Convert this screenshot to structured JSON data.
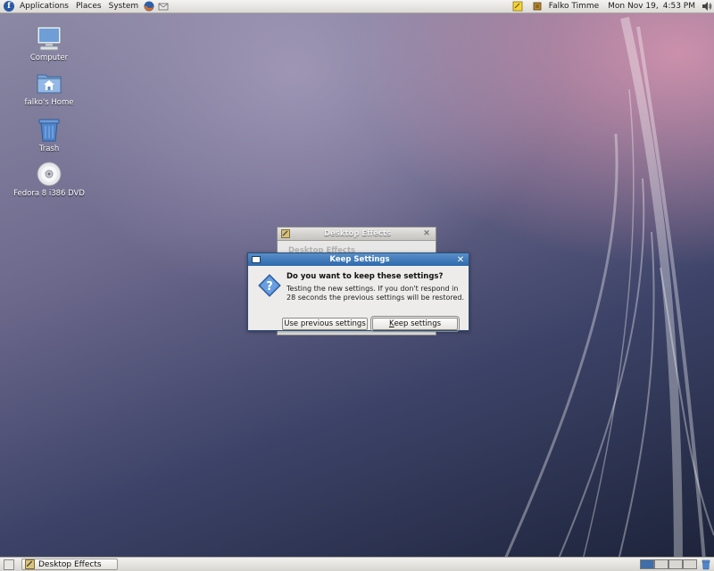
{
  "top_panel": {
    "menus": [
      "Applications",
      "Places",
      "System"
    ],
    "user": "Falko Timme",
    "date": "Mon Nov 19,",
    "time": "4:53 PM"
  },
  "desktop": {
    "icons": [
      {
        "label": "Computer",
        "icon": "computer-icon"
      },
      {
        "label": "falko's Home",
        "icon": "home-folder-icon"
      },
      {
        "label": "Trash",
        "icon": "trash-icon"
      },
      {
        "label": "Fedora 8 i386 DVD",
        "icon": "dvd-icon"
      }
    ]
  },
  "background_dialog": {
    "title": "Desktop Effects",
    "heading": "Desktop Effects"
  },
  "keep_dialog": {
    "title": "Keep Settings",
    "heading": "Do you want to keep these settings?",
    "message": "Testing the new settings. If you don't respond in 28 seconds the previous settings will be restored.",
    "button_previous": "Use previous settings",
    "button_keep_mnemonic": "K",
    "button_keep_rest": "eep settings"
  },
  "bottom_panel": {
    "taskbar_item": "Desktop Effects"
  },
  "colors": {
    "titlebar_active": "#2d69ac",
    "dialog_bg": "#edeceb",
    "panel_bg": "#dcdad5"
  }
}
